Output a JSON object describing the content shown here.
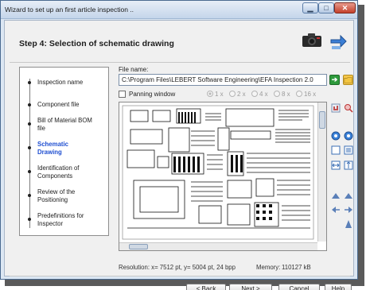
{
  "window": {
    "title": "Wizard to set up an first article inspection ..",
    "min_glyph": "▁",
    "max_glyph": "□",
    "close_glyph": "✕"
  },
  "header": {
    "step_title": "Step 4: Selection of schematic drawing"
  },
  "steps": [
    {
      "label": "Inspection name",
      "active": false
    },
    {
      "label": "Component file",
      "active": false
    },
    {
      "label": "Bill of Material BOM file",
      "active": false
    },
    {
      "label": "Schematic Drawing",
      "active": true
    },
    {
      "label": "Identification of Components",
      "active": false
    },
    {
      "label": "Review of the Positioning",
      "active": false
    },
    {
      "label": "Predefinitions for Inspector",
      "active": false
    }
  ],
  "file": {
    "label": "File name:",
    "value": "C:\\Program Files\\LEBERT Software Engineering\\EFA Inspection 2.0",
    "ok_glyph": "➔"
  },
  "panning": {
    "label": "Panning window",
    "checked": false
  },
  "zoom_options": [
    {
      "label": "1 x",
      "selected": true
    },
    {
      "label": "2 x",
      "selected": false
    },
    {
      "label": "4 x",
      "selected": false
    },
    {
      "label": "8 x",
      "selected": false
    },
    {
      "label": "16 x",
      "selected": false
    }
  ],
  "status": {
    "resolution": "Resolution: x= 7512 pt, y= 5004 pt, 24 bpp",
    "memory_label": "Memory:",
    "memory_value": "110127 kB"
  },
  "buttons": {
    "back": "< Back",
    "next": "Next >",
    "cancel": "Cancel",
    "help": "Help"
  },
  "colors": {
    "active_step": "#1f4fd1",
    "ok": "#2e9a3c",
    "folder": "#f5c64a"
  }
}
